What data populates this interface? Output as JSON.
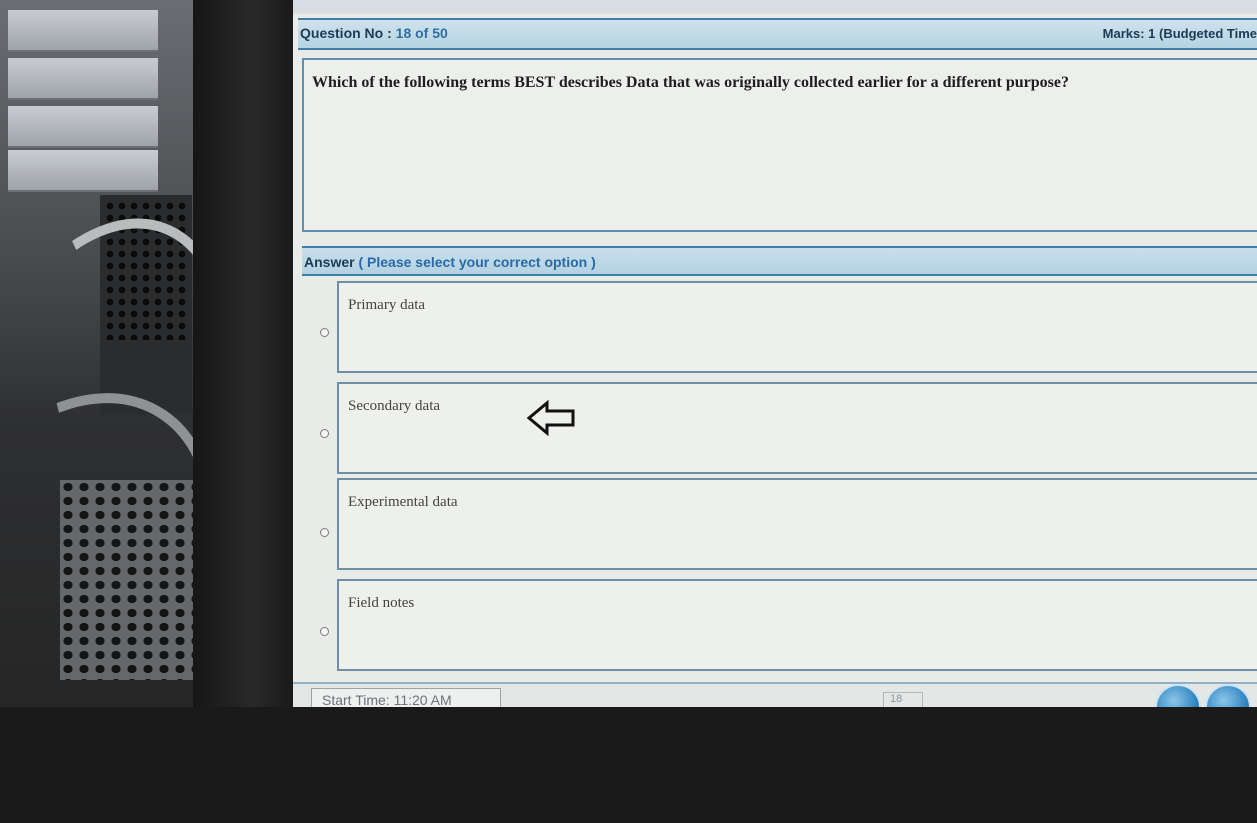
{
  "header": {
    "question_label": "Question No :",
    "question_number": "18 of 50",
    "marks": "Marks: 1 (Budgeted Time"
  },
  "question": {
    "text": "Which of the following terms BEST describes Data that was originally collected earlier for a different purpose?"
  },
  "answer": {
    "label": "Answer",
    "hint": "( Please select your correct option )",
    "options": [
      {
        "label": "Primary data",
        "selected": false
      },
      {
        "label": "Secondary data",
        "selected": false
      },
      {
        "label": "Experimental data",
        "selected": false
      },
      {
        "label": "Field notes",
        "selected": false
      }
    ]
  },
  "footer": {
    "start_time": "Start Time: 11:20 AM",
    "page_number": "18"
  },
  "annotation": {
    "icon": "left-arrow-icon"
  },
  "colors": {
    "header_bg": "#b6d3e2",
    "header_border": "#3f7fa6",
    "hint_text": "#2a69a6",
    "option_border": "#6f8fa5"
  }
}
